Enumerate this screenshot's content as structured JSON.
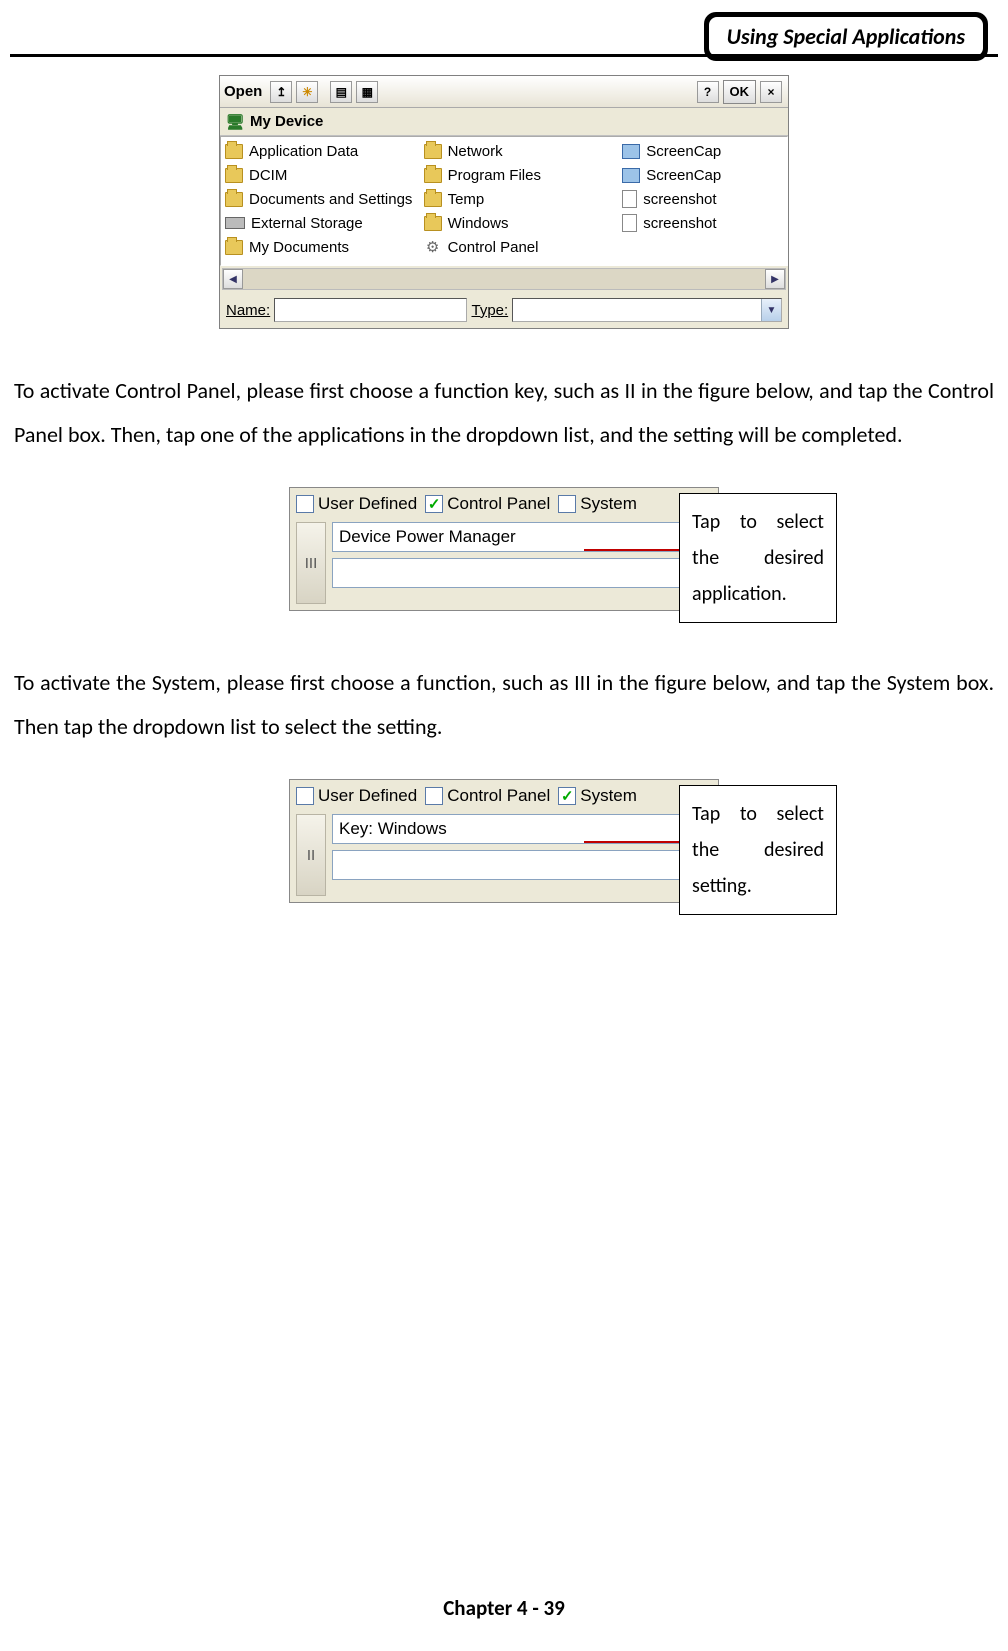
{
  "header": {
    "title": "Using Special Applications"
  },
  "openDialog": {
    "title": "Open",
    "okLabel": "OK",
    "location": "My Device",
    "col1": [
      "Application Data",
      "DCIM",
      "Documents and Settings",
      "External Storage",
      "My Documents"
    ],
    "col2": [
      "Network",
      "Program Files",
      "Temp",
      "Windows",
      "Control Panel"
    ],
    "col3": [
      "ScreenCap",
      "ScreenCap",
      "screenshot",
      "screenshot"
    ],
    "nameLabel": "Name:",
    "typeLabel": "Type:"
  },
  "para1": "To activate Control Panel, please first choose a function key, such as II in the figure below, and tap the Control Panel box. Then, tap one of the applications in the dropdown list, and the setting will be completed.",
  "panelCP": {
    "checks": [
      "User Defined",
      "Control Panel",
      "System"
    ],
    "checkedIndex": 1,
    "sideTab": "III",
    "dropdownValue": "Device Power Manager"
  },
  "callout1": "Tap to select the desired application.",
  "para2": "To activate the System, please first choose a function, such as III in the figure below, and tap the System box. Then tap the dropdown list to select the setting.",
  "panelSys": {
    "checks": [
      "User Defined",
      "Control Panel",
      "System"
    ],
    "checkedIndex": 2,
    "sideTab": "II",
    "dropdownValue": "Key: Windows"
  },
  "callout2": "Tap to select the desired setting.",
  "footer": "Chapter 4 - 39"
}
